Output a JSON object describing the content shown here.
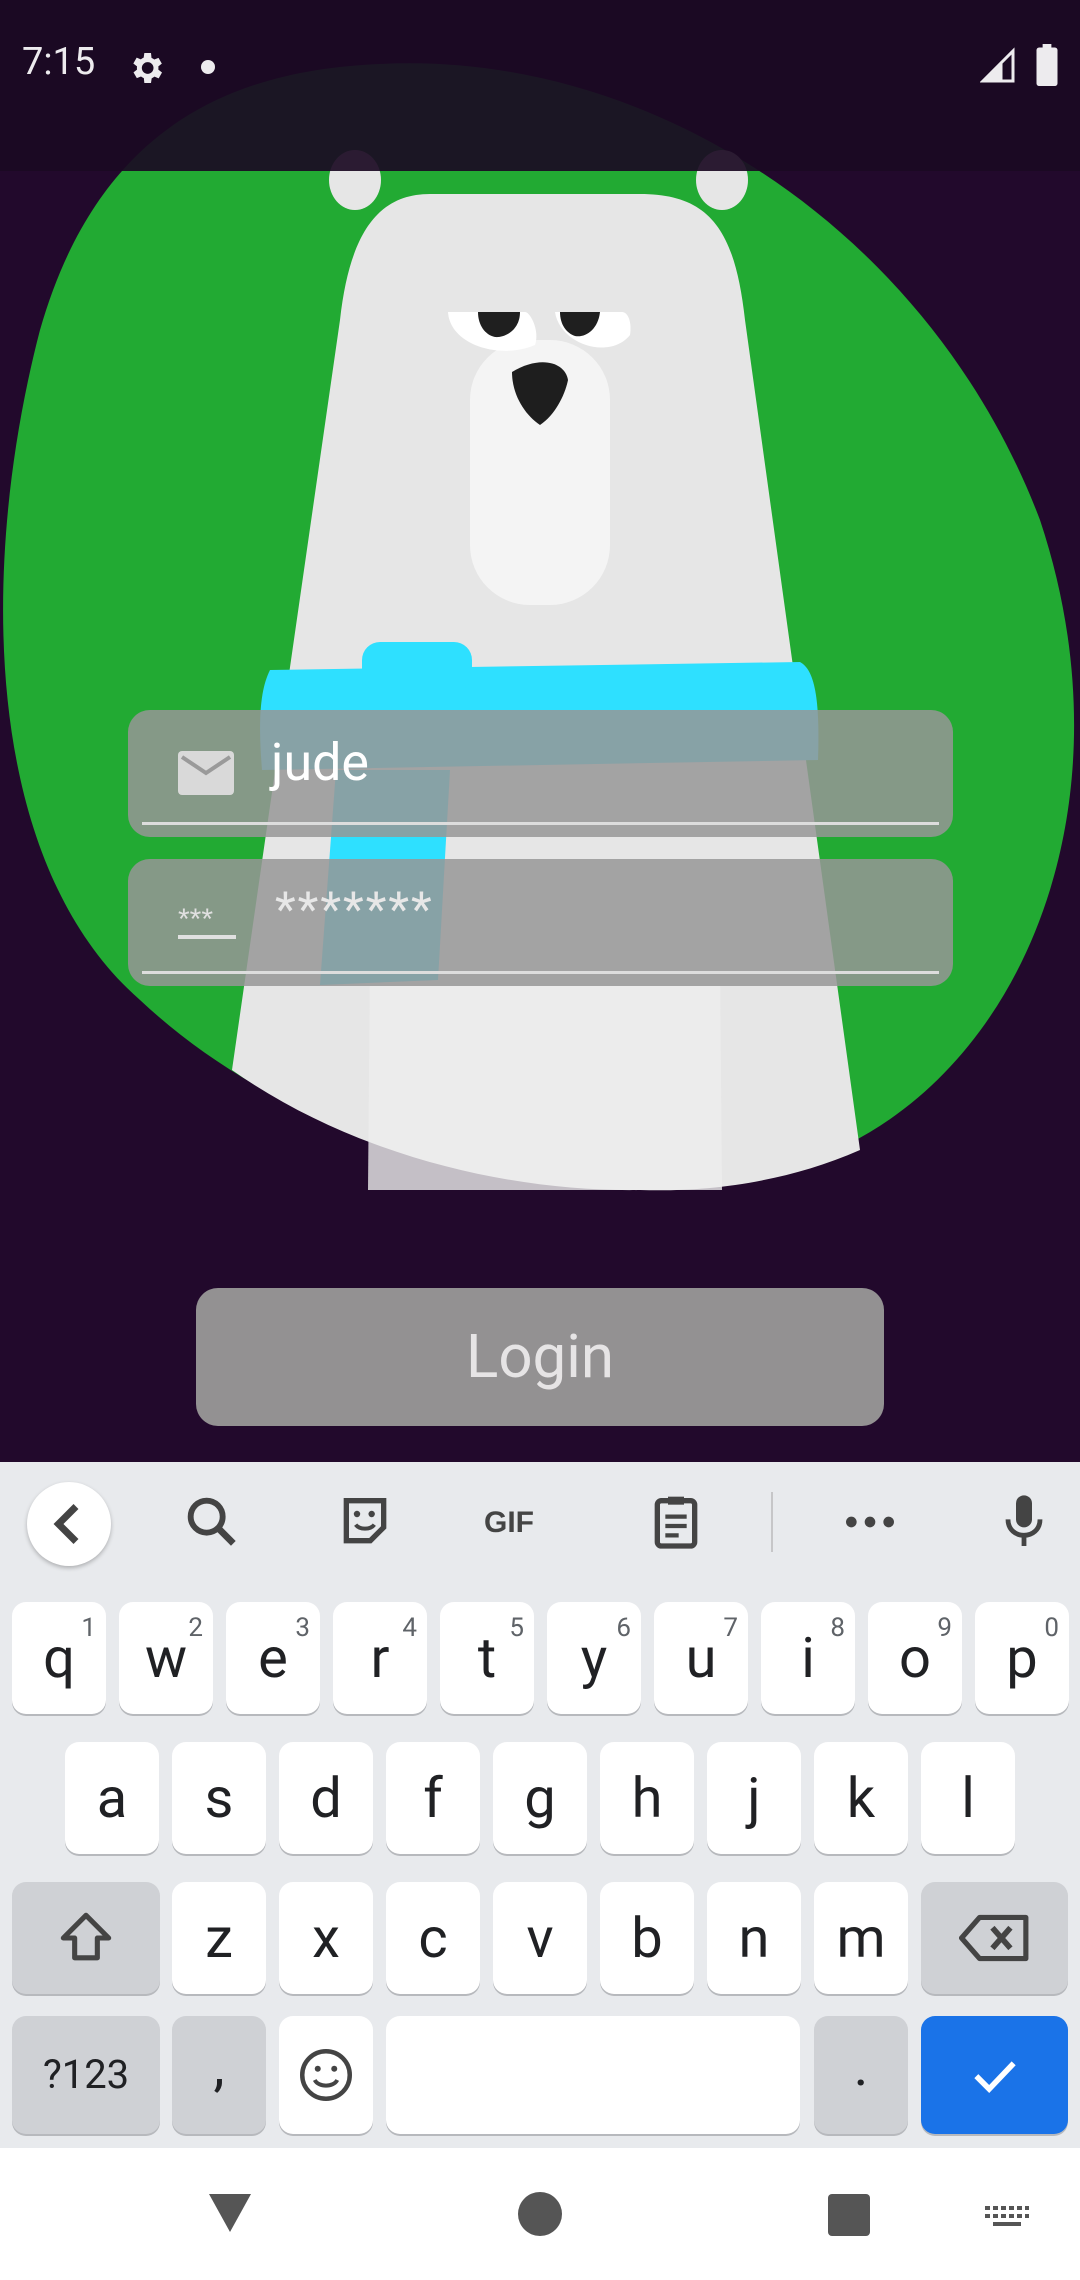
{
  "status_bar": {
    "time": "7:15",
    "icons": [
      "gear-icon",
      "dot-icon",
      "signal-icon",
      "battery-icon"
    ]
  },
  "login_form": {
    "username_value": "jude",
    "password_placeholder": "*******",
    "password_icon_text": "***",
    "login_label": "Login"
  },
  "keyboard": {
    "toolbar": [
      "chevron-left-icon",
      "search-icon",
      "sticker-icon",
      "GIF",
      "clipboard-icon",
      "more-icon",
      "mic-icon"
    ],
    "row1": [
      {
        "k": "q",
        "h": "1"
      },
      {
        "k": "w",
        "h": "2"
      },
      {
        "k": "e",
        "h": "3"
      },
      {
        "k": "r",
        "h": "4"
      },
      {
        "k": "t",
        "h": "5"
      },
      {
        "k": "y",
        "h": "6"
      },
      {
        "k": "u",
        "h": "7"
      },
      {
        "k": "i",
        "h": "8"
      },
      {
        "k": "o",
        "h": "9"
      },
      {
        "k": "p",
        "h": "0"
      }
    ],
    "row2": [
      "a",
      "s",
      "d",
      "f",
      "g",
      "h",
      "j",
      "k",
      "l"
    ],
    "row3": [
      "z",
      "x",
      "c",
      "v",
      "b",
      "n",
      "m"
    ],
    "row4": {
      "symbols": "?123",
      "comma": ",",
      "period": "."
    }
  },
  "colors": {
    "background": "#22092c",
    "blob_green": "#22aa33",
    "bear_white": "#e6e6e6",
    "scarf_cyan": "#2ee0ff",
    "enter_blue": "#1a73e8"
  }
}
